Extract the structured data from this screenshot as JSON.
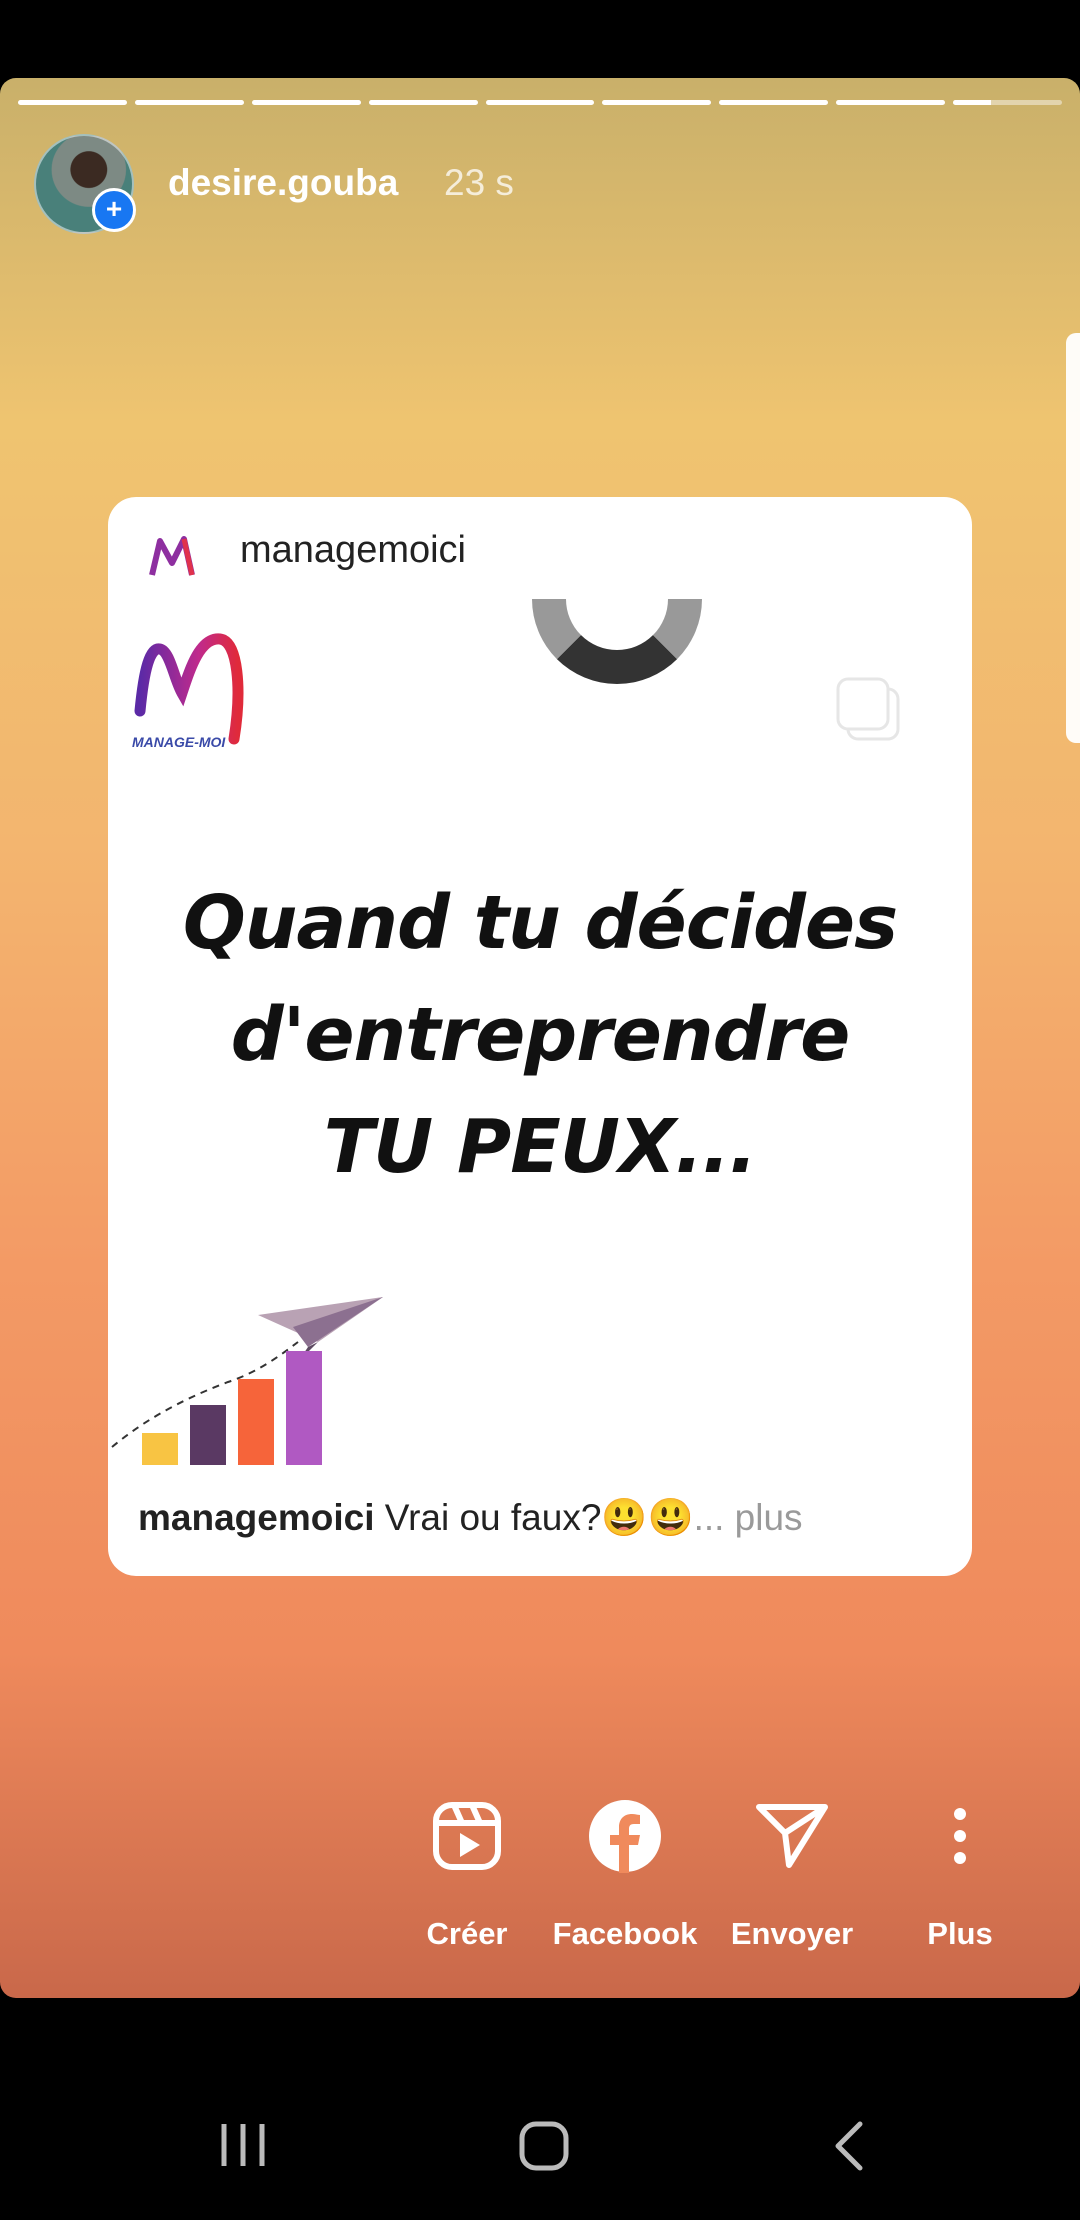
{
  "story": {
    "username": "desire.gouba",
    "time": "23 s",
    "progress_segments": 9,
    "progress_current": 9,
    "progress_current_fraction": 0.35
  },
  "post": {
    "username": "managemoici",
    "logo_text": "MANAGE-MOI",
    "headline": [
      "Quand tu décides",
      "d'entreprendre",
      "TU PEUX..."
    ],
    "caption_user": "managemoici",
    "caption_text": " Vrai ou faux?😃😃",
    "caption_more": "... plus"
  },
  "actions": [
    {
      "label": "Créer",
      "icon": "reels-icon"
    },
    {
      "label": "Facebook",
      "icon": "facebook-icon"
    },
    {
      "label": "Envoyer",
      "icon": "send-icon"
    },
    {
      "label": "Plus",
      "icon": "more-vertical-icon"
    }
  ],
  "colors": {
    "badge": "#1877f2",
    "gradient_top": "#c9b06a",
    "gradient_bottom": "#c9684a"
  }
}
